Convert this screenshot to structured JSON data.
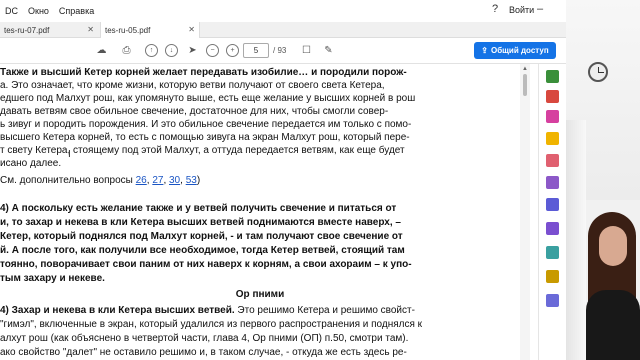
{
  "menu": {
    "items": [
      "DC",
      "Окно",
      "Справка"
    ],
    "signin": "Войти"
  },
  "tabs": [
    {
      "label": "tes-ru-07.pdf",
      "active": false
    },
    {
      "label": "tes-ru-05.pdf",
      "active": true
    }
  ],
  "toolbar": {
    "page_current": "5",
    "page_total": "/ 93",
    "share_label": "Общий доступ"
  },
  "document": {
    "lines": [
      {
        "text": "Также и высший Кетер корней желает передавать изобилие… и породили порож-",
        "bold": true
      },
      {
        "text": "а. Это означает, что кроме жизни, которую ветви получают от своего света Кетера,"
      },
      {
        "text": "едшего под Малхут рош, как упомянуто выше, есть еще желание у высших корней в рош"
      },
      {
        "text": "давать ветвям свое обильное свечение, достаточное для них, чтобы смогли совер-"
      },
      {
        "text": "ь зивуг и породить порождения. И это обильное свечение передается им только с помо-"
      },
      {
        "text": "высшего Кетера корней, то есть с помощью зивуга на экран Малхут рош, который пере-"
      },
      {
        "text": "т свету Кетера, стоящему под этой Малхут, а оттуда передается ветвям, как еще будет"
      },
      {
        "text": "исано далее."
      }
    ],
    "see_also": {
      "prefix": "См. дополнительно вопросы ",
      "links": [
        "26",
        "27",
        "30",
        "53"
      ],
      "suffix": ")"
    },
    "answer4": [
      "4) А поскольку есть желание также и у ветвей получить свечение и питаться от",
      "и, то захар и некева в кли Кетера высших ветвей поднимаются вместе наверх, –",
      "Кетер, который поднялся под Малхут корней, - и там получают свое свечение от",
      "й. А после того, как получили все необходимое, тогда Кетер ветвей, стоящий там",
      "тоянно, поворачивает свои паним от них наверх к корням, а свои ахораим – к упо-",
      "тым захару и некеве."
    ],
    "section_title": "Ор пними",
    "op_lines": [
      {
        "bold": "4) Захар и некева в кли Кетера высших ветвей.",
        "text": " Это решимо Кетера и решимо свойст-"
      },
      {
        "bold": "",
        "text": "\"гимэл\", включенные в экран, который удалился из первого распространения и поднялся к"
      },
      {
        "bold": "",
        "text": "алхут рош (как объяснено в четвертой части, глава 4, Ор пними (ОП) п.50, смотри там)."
      },
      {
        "bold": "",
        "text": "ако свойство \"далет\" не оставило решимо и, в таком случае, - откуда же есть здесь ре-"
      }
    ]
  },
  "colors": {
    "accent": "#1473e6",
    "link": "#1a55c4"
  }
}
